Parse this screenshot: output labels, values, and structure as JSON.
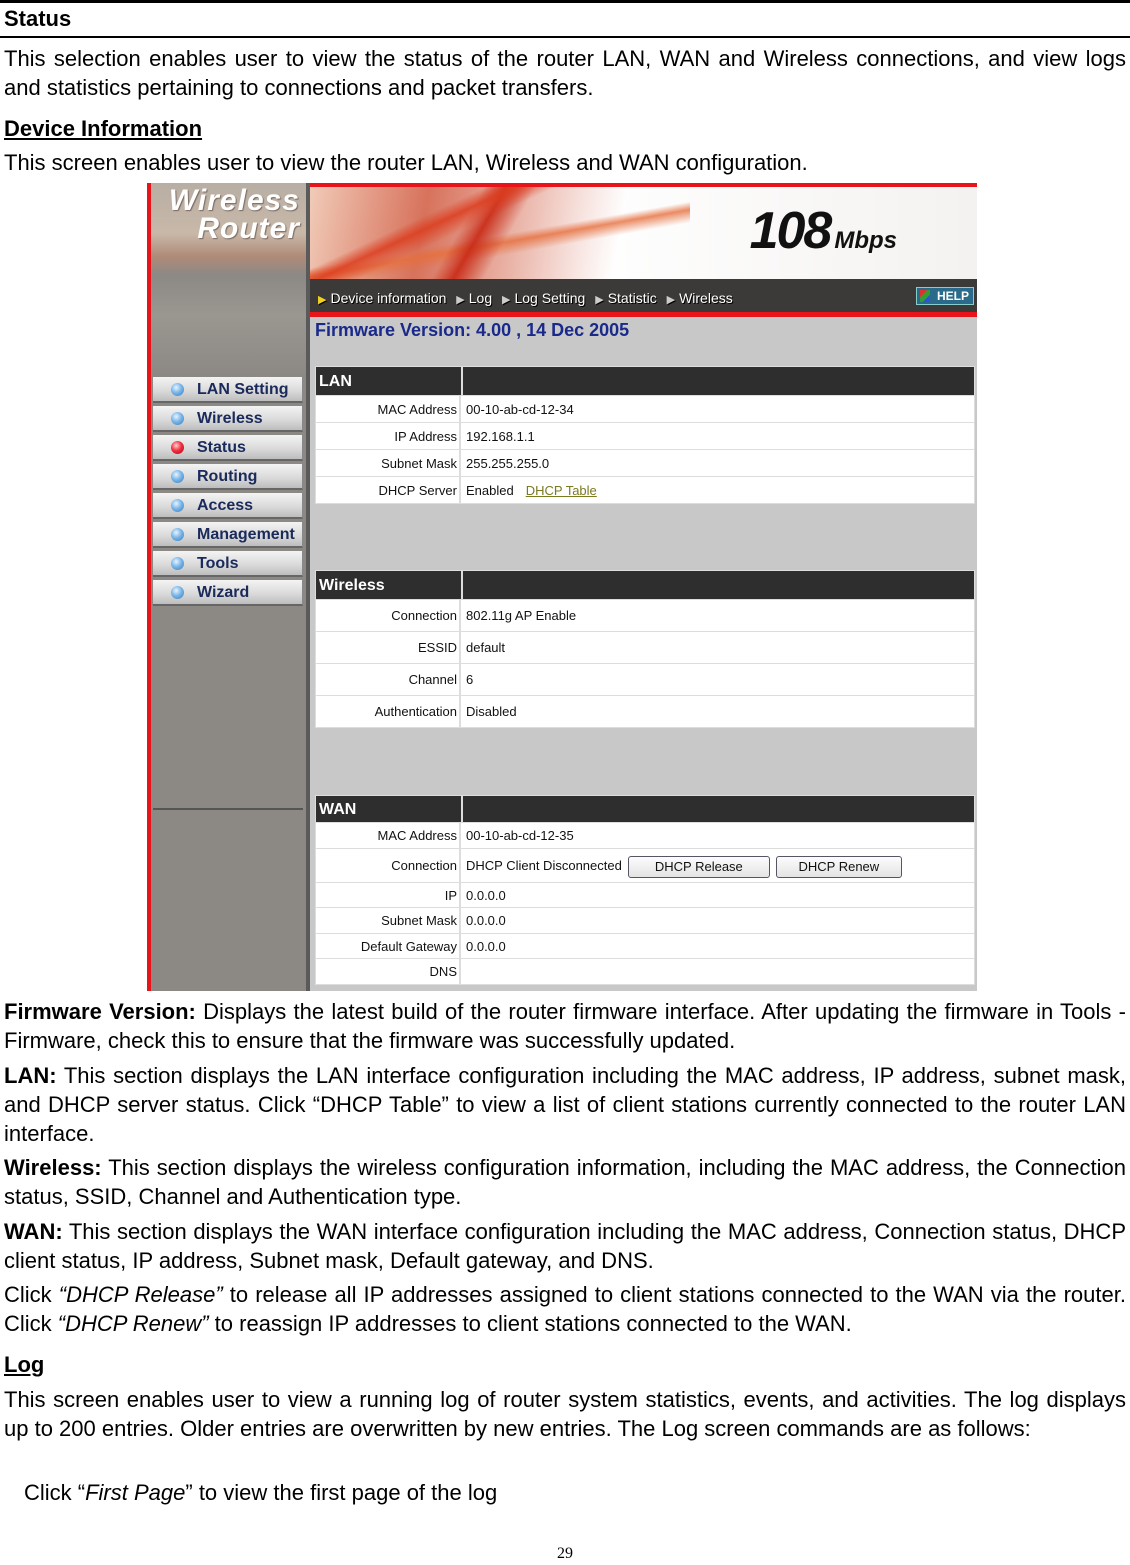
{
  "section_title": "Status",
  "intro": "This selection enables user to view the status of the router LAN, WAN and Wireless connections, and view logs and statistics pertaining to connections and packet transfers.",
  "device_info": {
    "heading": "Device Information",
    "text": "This screen enables user to view the router LAN, Wireless and WAN configuration."
  },
  "router_ui": {
    "logo_line1": "Wireless",
    "logo_line2": "Router",
    "speed": "108",
    "speed_unit": "Mbps",
    "tabs": [
      {
        "label": "Device information",
        "icon": "arrow-right-icon"
      },
      {
        "label": "Log",
        "icon": "arrow-right-icon"
      },
      {
        "label": "Log Setting",
        "icon": "arrow-right-icon"
      },
      {
        "label": "Statistic",
        "icon": "arrow-right-icon"
      },
      {
        "label": "Wireless",
        "icon": "arrow-right-icon"
      }
    ],
    "help_label": "HELP",
    "firmware": "Firmware Version: 4.00 , 14 Dec 2005",
    "sidebar": [
      {
        "label": "LAN Setting",
        "active": false
      },
      {
        "label": "Wireless",
        "active": false
      },
      {
        "label": "Status",
        "active": true
      },
      {
        "label": "Routing",
        "active": false
      },
      {
        "label": "Access",
        "active": false
      },
      {
        "label": "Management",
        "active": false
      },
      {
        "label": "Tools",
        "active": false
      },
      {
        "label": "Wizard",
        "active": false
      }
    ],
    "lan": {
      "title": "LAN",
      "rows": [
        {
          "label": "MAC Address",
          "value": "00-10-ab-cd-12-34"
        },
        {
          "label": "IP Address",
          "value": "192.168.1.1"
        },
        {
          "label": "Subnet Mask",
          "value": "255.255.255.0"
        },
        {
          "label": "DHCP Server",
          "value": "Enabled"
        }
      ],
      "dhcp_table_link": "DHCP Table"
    },
    "wireless": {
      "title": "Wireless",
      "rows": [
        {
          "label": "Connection",
          "value": "802.11g AP Enable"
        },
        {
          "label": "ESSID",
          "value": "default"
        },
        {
          "label": "Channel",
          "value": "6"
        },
        {
          "label": "Authentication",
          "value": "Disabled"
        }
      ]
    },
    "wan": {
      "title": "WAN",
      "rows": [
        {
          "label": "MAC Address",
          "value": "00-10-ab-cd-12-35"
        },
        {
          "label": "Connection",
          "value": "DHCP Client Disconnected"
        },
        {
          "label": "IP",
          "value": "0.0.0.0"
        },
        {
          "label": "Subnet Mask",
          "value": "0.0.0.0"
        },
        {
          "label": "Default Gateway",
          "value": "0.0.0.0"
        },
        {
          "label": "DNS",
          "value": ""
        }
      ],
      "release_button": "DHCP Release",
      "renew_button": "DHCP Renew"
    }
  },
  "descriptions": {
    "firmware_label": "Firmware Version:",
    "firmware_text": " Displays the latest build of the router firmware interface. After updating the firmware in Tools - Firmware, check this to ensure that the firmware was successfully updated.",
    "lan_label": "LAN:",
    "lan_text": " This section displays the LAN interface configuration including the MAC address, IP address, subnet mask, and DHCP server status. Click “DHCP Table” to view a list of client stations currently connected to the router LAN interface.",
    "wireless_label": "Wireless:",
    "wireless_text": " This section displays the wireless configuration information, including the MAC address, the Connection status, SSID, Channel and Authentication type.",
    "wan_label": "WAN:",
    "wan_text": " This section displays the WAN interface configuration including the MAC address, Connection status, DHCP client status, IP address, Subnet mask, Default gateway, and DNS.",
    "click1_a": "Click ",
    "click1_em": "“DHCP Release”",
    "click1_b": " to release all IP addresses assigned to client stations connected to the WAN via the router. Click ",
    "click1_em2": "“DHCP Renew”",
    "click1_c": " to reassign IP addresses to client stations connected to the WAN."
  },
  "log": {
    "heading": "Log",
    "text": "This screen enables user to view a running log of router system statistics, events, and activities. The log displays up to 200 entries. Older entries are overwritten by new entries. The Log screen commands are as follows:",
    "cmd_a": "Click “",
    "cmd_em": "First Page",
    "cmd_b": "” to view the first page of the log"
  },
  "page_number": "29"
}
